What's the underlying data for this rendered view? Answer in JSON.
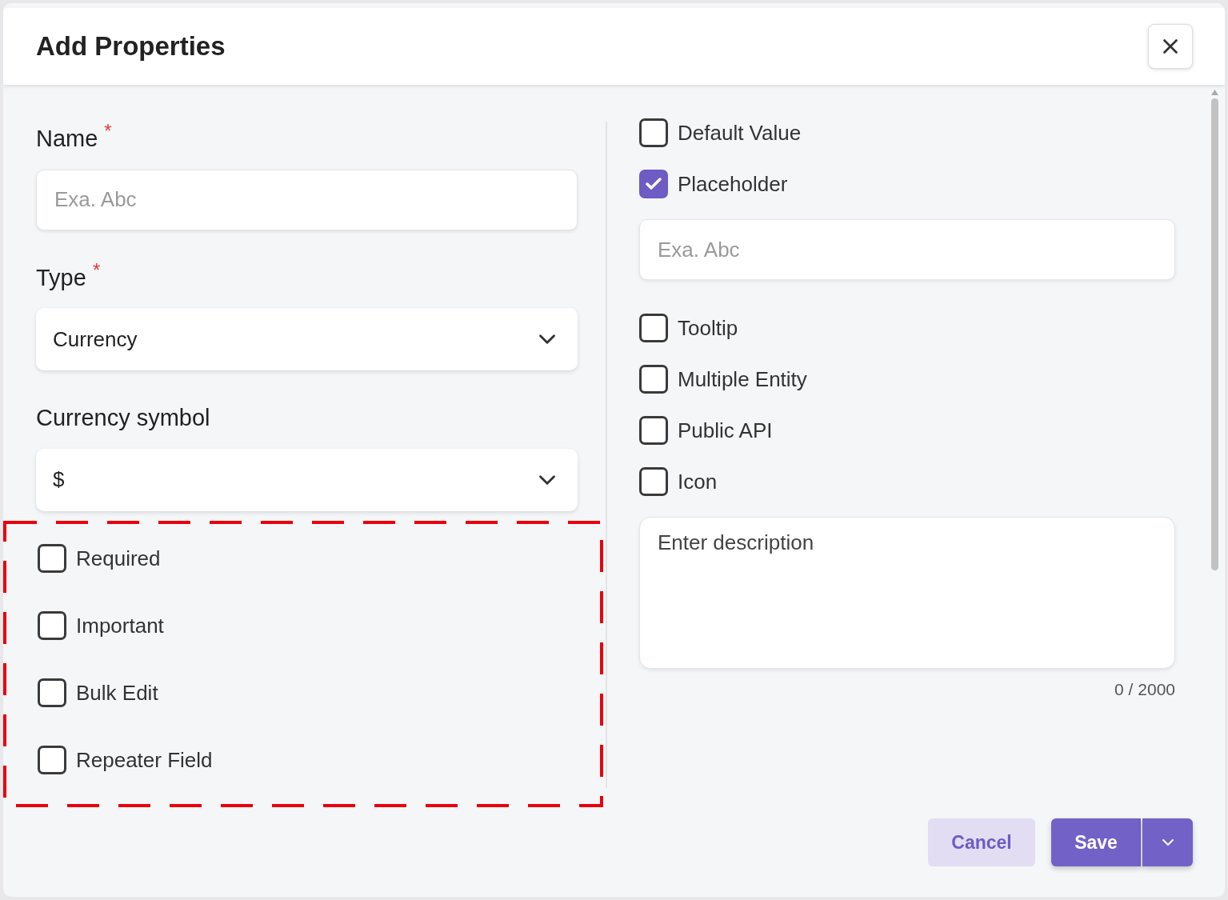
{
  "dialog": {
    "title": "Add Properties"
  },
  "left": {
    "fields": [
      {
        "kind": "text",
        "label": "Name",
        "required_mark": "*",
        "placeholder": "Exa. Abc"
      },
      {
        "kind": "select",
        "label": "Type",
        "required_mark": "*",
        "value": "Currency"
      },
      {
        "kind": "select",
        "label": "Currency symbol",
        "value": "$"
      }
    ],
    "options": [
      {
        "label": "Required",
        "checked": false
      },
      {
        "label": "Important",
        "checked": false
      },
      {
        "label": "Bulk Edit",
        "checked": false
      },
      {
        "label": "Repeater Field",
        "checked": false
      }
    ]
  },
  "right": {
    "items": [
      {
        "kind": "checkbox",
        "label": "Default Value",
        "checked": false
      },
      {
        "kind": "checkbox",
        "label": "Placeholder",
        "checked": true
      },
      {
        "kind": "input",
        "placeholder": "Exa. Abc"
      },
      {
        "kind": "checkbox",
        "label": "Tooltip",
        "checked": false
      },
      {
        "kind": "checkbox",
        "label": "Multiple Entity",
        "checked": false
      },
      {
        "kind": "checkbox",
        "label": "Public API",
        "checked": false
      },
      {
        "kind": "checkbox",
        "label": "Icon",
        "checked": false
      },
      {
        "kind": "textarea",
        "placeholder": "Enter description",
        "counter": "0 / 2000"
      }
    ]
  },
  "footer": {
    "cancel": "Cancel",
    "save": "Save"
  }
}
